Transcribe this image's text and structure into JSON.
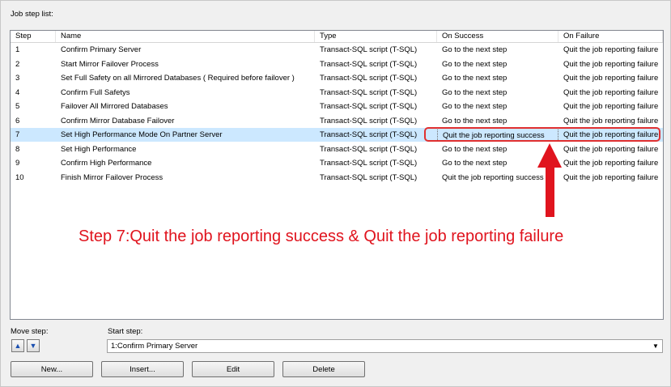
{
  "job_step_list_label": "Job step list:",
  "columns": [
    "Step",
    "Name",
    "Type",
    "On Success",
    "On Failure"
  ],
  "rows": [
    {
      "step": "1",
      "name": "Confirm Primary Server",
      "type": "Transact-SQL script (T-SQL)",
      "on_success": "Go to the next step",
      "on_failure": "Quit the job reporting failure"
    },
    {
      "step": "2",
      "name": "Start Mirror Failover Process",
      "type": "Transact-SQL script (T-SQL)",
      "on_success": "Go to the next step",
      "on_failure": "Quit the job reporting failure"
    },
    {
      "step": "3",
      "name": "Set Full Safety on all Mirrored Databases ( Required before failover )",
      "type": "Transact-SQL script (T-SQL)",
      "on_success": "Go to the next step",
      "on_failure": "Quit the job reporting failure"
    },
    {
      "step": "4",
      "name": "Confirm Full Safetys",
      "type": "Transact-SQL script (T-SQL)",
      "on_success": "Go to the next step",
      "on_failure": "Quit the job reporting failure"
    },
    {
      "step": "5",
      "name": "Failover All Mirrored Databases",
      "type": "Transact-SQL script (T-SQL)",
      "on_success": "Go to the next step",
      "on_failure": "Quit the job reporting failure"
    },
    {
      "step": "6",
      "name": "Confirm Mirror Database Failover",
      "type": "Transact-SQL script (T-SQL)",
      "on_success": "Go to the next step",
      "on_failure": "Quit the job reporting failure"
    },
    {
      "step": "7",
      "name": "Set High Performance Mode On Partner Server",
      "type": "Transact-SQL script (T-SQL)",
      "on_success": "Quit the job reporting success",
      "on_failure": "Quit the job reporting failure"
    },
    {
      "step": "8",
      "name": "Set High Performance",
      "type": "Transact-SQL script (T-SQL)",
      "on_success": "Go to the next step",
      "on_failure": "Quit the job reporting failure"
    },
    {
      "step": "9",
      "name": "Confirm High Performance",
      "type": "Transact-SQL script (T-SQL)",
      "on_success": "Go to the next step",
      "on_failure": "Quit the job reporting failure"
    },
    {
      "step": "10",
      "name": "Finish Mirror Failover Process",
      "type": "Transact-SQL script (T-SQL)",
      "on_success": "Quit the job reporting success",
      "on_failure": "Quit the job reporting failure"
    }
  ],
  "selected_step": "7",
  "annotation": "Step 7:Quit the job reporting success  & Quit the job reporting failure",
  "annotation_color": "#e0141e",
  "selection_color": "#cce8ff",
  "move_step_label": "Move step:",
  "move_up_icon": "arrow-up-icon",
  "move_down_icon": "arrow-down-icon",
  "start_step_label": "Start step:",
  "start_step_value": "1:Confirm Primary Server",
  "buttons": {
    "new": "New...",
    "insert": "Insert...",
    "edit": "Edit",
    "delete": "Delete"
  }
}
